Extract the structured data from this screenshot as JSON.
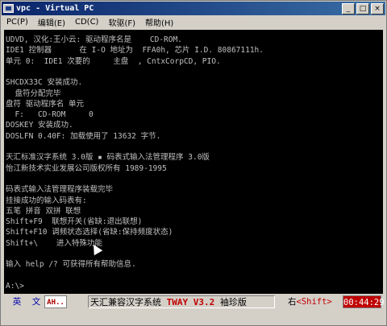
{
  "window": {
    "title": "vpc - Virtual PC",
    "buttons": {
      "minimize": "_",
      "maximize": "□",
      "close": "×"
    }
  },
  "menu": [
    "PC(P)",
    "编辑(E)",
    "CD(C)",
    "软驱(F)",
    "帮助(H)"
  ],
  "terminal": {
    "lines": [
      "UDVD, 汉化:王小云: 驱动程序名是    CD-ROM.",
      "IDE1 控制器      在 I-O 地址为  FFA0h, 芯片 I.D. 80867111h.",
      "单元 0:  IDE1 次要的     主盘  , CntxCorpCD, PIO.",
      "",
      "SHCDX33C 安装成功.",
      "  盘符分配完毕",
      "盘符 驱动程序名 单元",
      "  F:   CD-ROM     0",
      "DOSKEY 安装成功.",
      "DOSLFN 0.40F: 加载使用了 13632 字节.",
      "",
      "天汇标准汉字系统 3.0版 ▪ 码表式输入法管理程序 3.0版",
      "怡江新技术实业发展公司版权所有 1989-1995",
      "",
      "码表式输入法管理程序装载完毕",
      "挂接成功的输入码表有:",
      "五笔 拼音 双拼 联想",
      "Shift+F9  联想开关(省缺:退出联想)",
      "Shift+F10 调频状态选择(省缺:保持频度状态)",
      "Shift+\\    进入特殊功能",
      "",
      "输入 help /? 可获得所有帮助信息.",
      "",
      "A:\\>"
    ]
  },
  "status": {
    "english": "英",
    "wen": "文",
    "ah": "AH..",
    "system_name": "天汇兼容汉字系统",
    "version": "TWAY V3.2",
    "edition": "袖珍版",
    "right_label": "右",
    "shift": "<Shift>",
    "time": "00:44:29"
  },
  "colors": {
    "title_bar": "#0a246a",
    "terminal_bg": "#000000",
    "terminal_text": "#c0c0c0",
    "status_accent": "#c00000"
  }
}
